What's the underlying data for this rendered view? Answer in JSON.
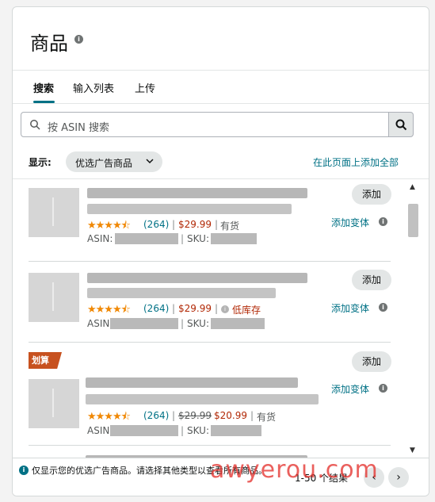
{
  "header": {
    "title": "商品"
  },
  "tabs": [
    {
      "label": "搜索"
    },
    {
      "label": "输入列表"
    },
    {
      "label": "上传"
    }
  ],
  "search": {
    "placeholder": "按 ASIN 搜索"
  },
  "filter": {
    "show_label": "显示:",
    "dropdown_value": "优选广告商品",
    "add_all": "在此页面上添加全部"
  },
  "products": [
    {
      "stars": "★★★★⯪",
      "reviews": "(264)",
      "price": "$29.99",
      "old_price": "",
      "stock": "有货",
      "out_of_stock": "",
      "asin_label": "ASIN:",
      "sku_label": "SKU:",
      "add": "添加",
      "variant": "添加变体",
      "deal": ""
    },
    {
      "stars": "★★★★⯪",
      "reviews": "(264)",
      "price": "$29.99",
      "old_price": "",
      "stock": "",
      "out_of_stock": "低库存",
      "asin_label": "ASIN:",
      "sku_label": "SKU:",
      "add": "添加",
      "variant": "添加变体",
      "deal": ""
    },
    {
      "stars": "★★★★⯪",
      "reviews": "(264)",
      "price": "$20.99",
      "old_price": "$29.99",
      "stock": "有货",
      "out_of_stock": "",
      "asin_label": "ASIN:",
      "sku_label": "SKU:",
      "add": "添加",
      "variant": "添加变体",
      "deal": "划算"
    }
  ],
  "footer": {
    "notice": "仅显示您的优选广告商品。请选择其他类型以查看所有商品。",
    "count": "1-50 个结果",
    "prev": "‹",
    "next": "›"
  },
  "watermark": "awyerou.com",
  "colors": {
    "link": "#007185",
    "price": "#b12704",
    "star": "#f08804",
    "deal": "#c7511f"
  }
}
